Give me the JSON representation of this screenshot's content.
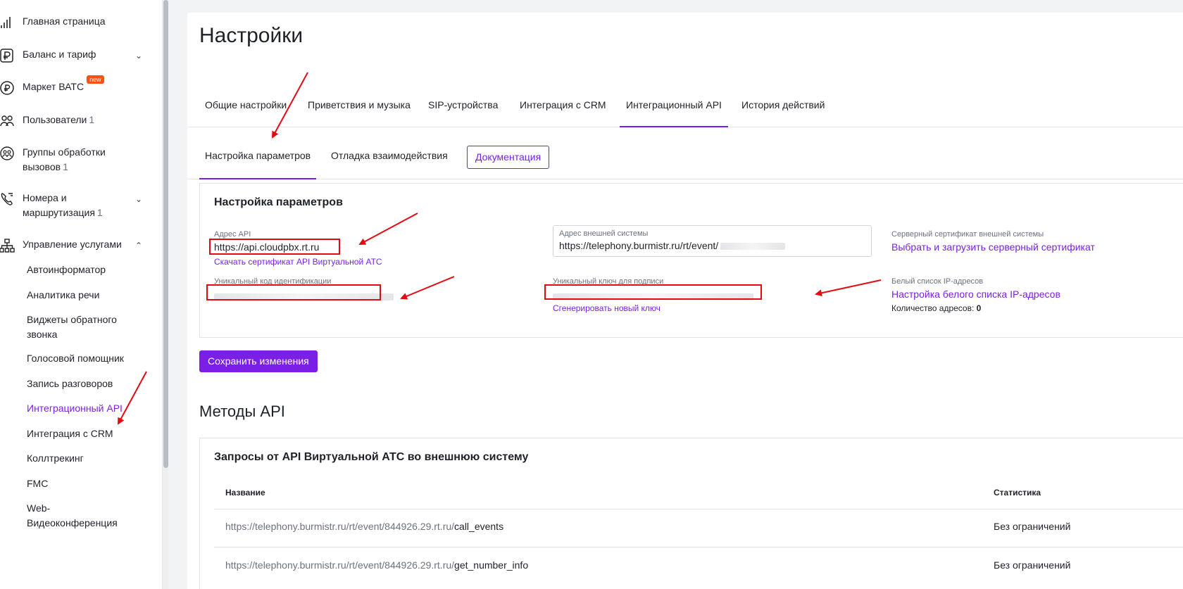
{
  "sidebar": {
    "items": [
      {
        "label": "Главная страница",
        "icon": "chart-icon"
      },
      {
        "label": "Баланс и тариф",
        "icon": "ruble-icon"
      },
      {
        "label": "Маркет ВАТС",
        "icon": "market-icon",
        "badge": "new"
      },
      {
        "label": "Пользователи",
        "icon": "users-icon",
        "count": "1"
      },
      {
        "label": "Группы обработки вызовов",
        "icon": "group-icon",
        "count": "1"
      },
      {
        "label": "Номера и маршрутизация",
        "icon": "phone-icon",
        "count": "1"
      },
      {
        "label": "Управление услугами",
        "icon": "hierarchy-icon"
      }
    ],
    "sub_items": [
      "Автоинформатор",
      "Аналитика речи",
      "Виджеты обратного звонка",
      "Голосовой помощник",
      "Запись разговоров",
      "Интеграционный API",
      "Интеграция с CRM",
      "Коллтрекинг",
      "FMC",
      "Web-Видеоконференция"
    ]
  },
  "page_title": "Настройки",
  "tabs": [
    "Общие настройки",
    "Приветствия и музыка",
    "SIP-устройства",
    "Интеграция с CRM",
    "Интеграционный API",
    "История действий"
  ],
  "subtabs": [
    "Настройка параметров",
    "Отладка взаимодействия"
  ],
  "doc_button": "Документация",
  "params": {
    "title": "Настройка параметров",
    "api_address_label": "Адрес API",
    "api_address_value": "https://api.cloudpbx.rt.ru",
    "download_cert_link": "Скачать сертификат API Виртуальной АТС",
    "unique_id_label": "Уникальный код идентификации",
    "ext_system_label": "Адрес внешней системы",
    "ext_system_value": "https://telephony.burmistr.ru/rt/event/",
    "sign_key_label": "Уникальный ключ для подписи",
    "generate_key_link": "Сгенерировать новый ключ",
    "server_cert_label": "Серверный сертификат внешней системы",
    "server_cert_link": "Выбрать и загрузить серверный сертификат",
    "whitelist_label": "Белый список IP-адресов",
    "whitelist_link": "Настройка белого списка IP-адресов",
    "address_count_label": "Количество адресов:",
    "address_count_value": "0"
  },
  "save_button": "Сохранить изменения",
  "methods": {
    "section_title": "Методы API",
    "card_title": "Запросы от API Виртуальной АТС во внешнюю систему",
    "col_name": "Название",
    "col_stats": "Статистика",
    "rows": [
      {
        "prefix": "https://telephony.burmistr.ru/rt/event/844926.29.rt.ru/",
        "method": "call_events",
        "stats": "Без ограничений"
      },
      {
        "prefix": "https://telephony.burmistr.ru/rt/event/844926.29.rt.ru/",
        "method": "get_number_info",
        "stats": "Без ограничений"
      }
    ]
  },
  "colors": {
    "accent": "#7b1fe6",
    "annotation": "#e30b12",
    "badge": "#ff4f12"
  }
}
